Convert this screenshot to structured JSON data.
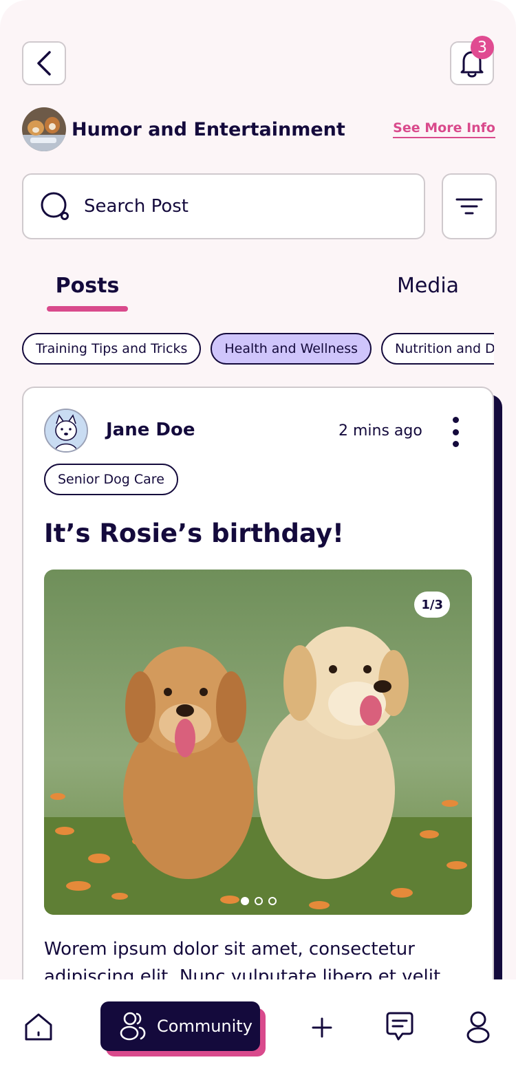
{
  "header": {
    "notification_count": "3",
    "community_title": "Humor and Entertainment",
    "see_more_label": "See More Info"
  },
  "search": {
    "placeholder": "Search Post"
  },
  "tabs": [
    {
      "label": "Posts",
      "active": true
    },
    {
      "label": "Media",
      "active": false
    }
  ],
  "filter_chips": [
    {
      "label": "Training Tips and Tricks",
      "active": false
    },
    {
      "label": "Health and Wellness",
      "active": true
    },
    {
      "label": "Nutrition and Diet",
      "active": false
    }
  ],
  "post": {
    "author": "Jane Doe",
    "time": "2 mins ago",
    "tag": "Senior Dog Care",
    "title": "It’s Rosie’s birthday!",
    "image_counter": "1/3",
    "body": "Worem ipsum dolor sit amet, consectetur adipiscing elit. Nunc vulputate libero et velit"
  },
  "bottom_nav": {
    "community_label": "Community"
  },
  "colors": {
    "accent_pink": "#d94a8c",
    "navy": "#140a3c",
    "chip_active": "#cfc5fb",
    "background": "#fcf5f7"
  }
}
